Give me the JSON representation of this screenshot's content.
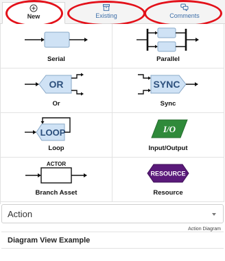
{
  "tabs": [
    {
      "label": "New",
      "icon": "plus-circle-icon"
    },
    {
      "label": "Existing",
      "icon": "archive-box-icon"
    },
    {
      "label": "Comments",
      "icon": "chat-bubbles-icon"
    }
  ],
  "shapes": [
    {
      "label": "Serial",
      "icon": "serial-block-icon"
    },
    {
      "label": "Parallel",
      "icon": "parallel-block-icon"
    },
    {
      "label": "Or",
      "icon": "or-gate-icon",
      "text": "OR"
    },
    {
      "label": "Sync",
      "icon": "sync-gate-icon",
      "text": "SYNC"
    },
    {
      "label": "Loop",
      "icon": "loop-icon",
      "text": "LOOP"
    },
    {
      "label": "Input/Output",
      "icon": "input-output-icon",
      "text": "I/O"
    },
    {
      "label": "Branch Asset",
      "icon": "branch-asset-icon",
      "text": "ACTOR"
    },
    {
      "label": "Resource",
      "icon": "resource-icon",
      "text": "RESOURCE"
    }
  ],
  "type_select": {
    "value": "Action"
  },
  "hint_text": "Action Diagram",
  "example_title": "Diagram View Example",
  "colors": {
    "highlight_ring": "#e3111a",
    "tab_link": "#3d6ea8",
    "shape_fill": "#cfe2f5",
    "io_fill": "#2f8a3a",
    "resource_fill": "#5a1a7a"
  }
}
